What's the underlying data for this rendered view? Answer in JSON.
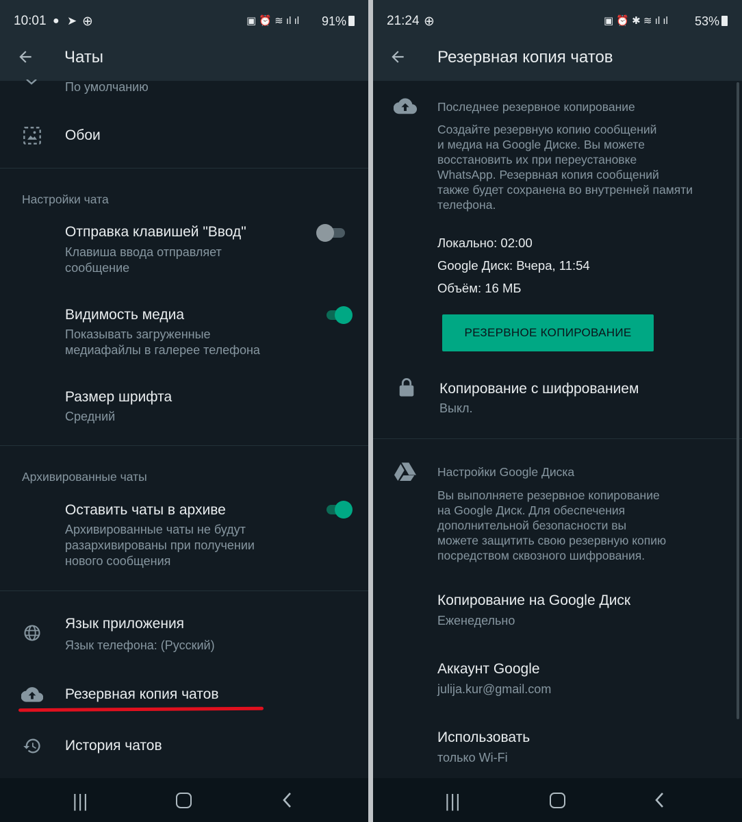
{
  "left": {
    "status": {
      "time": "10:01",
      "battery": "91%"
    },
    "header": {
      "title": "Чаты"
    },
    "items": {
      "theme_subtitle": "По умолчанию",
      "wallpaper": "Обои",
      "section_chat": "Настройки чата",
      "enter_title": "Отправка клавишей \"Ввод\"",
      "enter_sub1": "Клавиша ввода отправляет",
      "enter_sub2": "сообщение",
      "enter_on": false,
      "media_title": "Видимость медиа",
      "media_sub1": "Показывать загруженные",
      "media_sub2": "медиафайлы в галерее телефона",
      "media_on": true,
      "font_title": "Размер шрифта",
      "font_sub": "Средний",
      "section_archive": "Архивированные чаты",
      "archive_title": "Оставить чаты в архиве",
      "archive_sub1": "Архивированные чаты не будут",
      "archive_sub2": "разархивированы при получении",
      "archive_sub3": "нового сообщения",
      "archive_on": true,
      "lang_title": "Язык приложения",
      "lang_sub": "Язык телефона: (Русский)",
      "backup": "Резервная копия чатов",
      "history": "История чатов"
    }
  },
  "right": {
    "status": {
      "time": "21:24",
      "battery": "53%"
    },
    "header": {
      "title": "Резервная копия чатов"
    },
    "last": {
      "title": "Последнее резервное копирование",
      "desc1": "Создайте резервную копию сообщений",
      "desc2": "и медиа на Google Диске. Вы можете",
      "desc3": "восстановить их при переустановке",
      "desc4": "WhatsApp. Резервная копия сообщений",
      "desc5": "также будет сохранена во внутренней памяти",
      "desc6": "телефона.",
      "local": "Локально: 02:00",
      "drive": "Google Диск: Вчера, 11:54",
      "size": "Объём: 16 МБ",
      "button": "РЕЗЕРВНОЕ КОПИРОВАНИЕ"
    },
    "encrypt": {
      "title": "Копирование с шифрованием",
      "sub": "Выкл."
    },
    "gdrive": {
      "title": "Настройки Google Диска",
      "desc1": "Вы выполняете резервное копирование",
      "desc2": "на Google Диск. Для обеспечения",
      "desc3": "дополнительной безопасности вы",
      "desc4": "можете защитить свою резервную копию",
      "desc5": "посредством сквозного шифрования.",
      "copy_title": "Копирование на Google Диск",
      "copy_sub": "Еженедельно",
      "account_title": "Аккаунт Google",
      "account_sub": "julija.kur@gmail.com",
      "use_title": "Использовать",
      "use_sub": "только Wi-Fi"
    }
  },
  "colors": {
    "accent": "#00a884",
    "bg": "#121b22",
    "bar": "#1f2c34",
    "highlight": "#e0101e"
  }
}
